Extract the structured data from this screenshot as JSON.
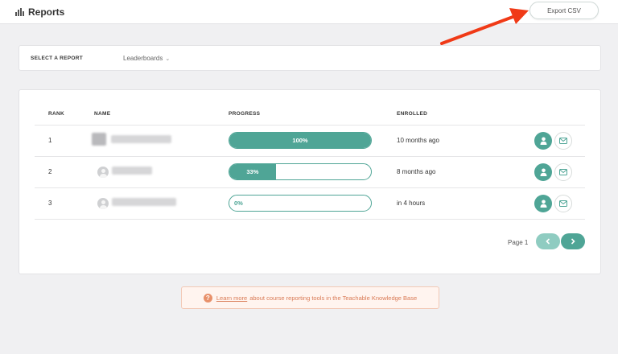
{
  "header": {
    "title": "Reports",
    "icon": "bar-chart-icon",
    "export_label": "Export CSV"
  },
  "selector": {
    "label": "SELECT A REPORT",
    "value": "Leaderboards"
  },
  "table": {
    "columns": [
      "RANK",
      "NAME",
      "PROGRESS",
      "ENROLLED"
    ],
    "rows": [
      {
        "rank": "1",
        "progress_label": "100%",
        "progress": 1.0,
        "enrolled": "10 months ago"
      },
      {
        "rank": "2",
        "progress_label": "33%",
        "progress": 0.33,
        "enrolled": "8 months ago"
      },
      {
        "rank": "3",
        "progress_label": "0%",
        "progress": 0.0,
        "enrolled": "in 4 hours"
      }
    ]
  },
  "pagination": {
    "label": "Page 1"
  },
  "kb": {
    "link_text": "Learn more",
    "rest_text": "about course reporting tools in the Teachable Knowledge Base"
  },
  "colors": {
    "accent": "#4fa596",
    "accent_light": "#8fccc1",
    "arrow": "#f03a17",
    "kb_text": "#d97a55"
  }
}
